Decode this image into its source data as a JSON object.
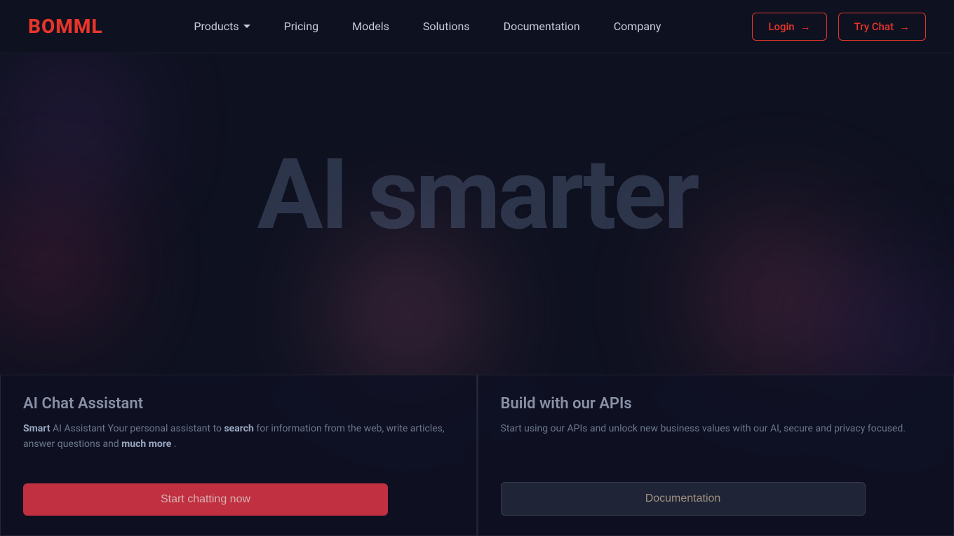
{
  "brand": {
    "logo": "BOMML"
  },
  "nav": {
    "links": [
      {
        "id": "products",
        "label": "Products",
        "has_dropdown": true
      },
      {
        "id": "pricing",
        "label": "Pricing",
        "has_dropdown": false
      },
      {
        "id": "models",
        "label": "Models",
        "has_dropdown": false
      },
      {
        "id": "solutions",
        "label": "Solutions",
        "has_dropdown": false
      },
      {
        "id": "documentation",
        "label": "Documentation",
        "has_dropdown": false
      },
      {
        "id": "company",
        "label": "Company",
        "has_dropdown": false
      }
    ],
    "login_label": "Login",
    "try_chat_label": "Try Chat"
  },
  "hero": {
    "title": "AI smarter"
  },
  "cards": [
    {
      "id": "ai-chat-assistant",
      "title": "AI Chat Assistant",
      "description_parts": [
        {
          "text": "Smart",
          "bold": true
        },
        {
          "text": " AI Assistant Your personal assistant to ",
          "bold": false
        },
        {
          "text": "search",
          "bold": true
        },
        {
          "text": " for information from the web, write articles, answer questions and ",
          "bold": false
        },
        {
          "text": "much more",
          "bold": true
        },
        {
          "text": ".",
          "bold": false
        }
      ],
      "button_label": "Start chatting now"
    },
    {
      "id": "build-with-apis",
      "title": "Build with our APIs",
      "description": "Start using our APIs and unlock new business values with our AI, secure and privacy focused.",
      "button_label": "Documentation"
    }
  ]
}
